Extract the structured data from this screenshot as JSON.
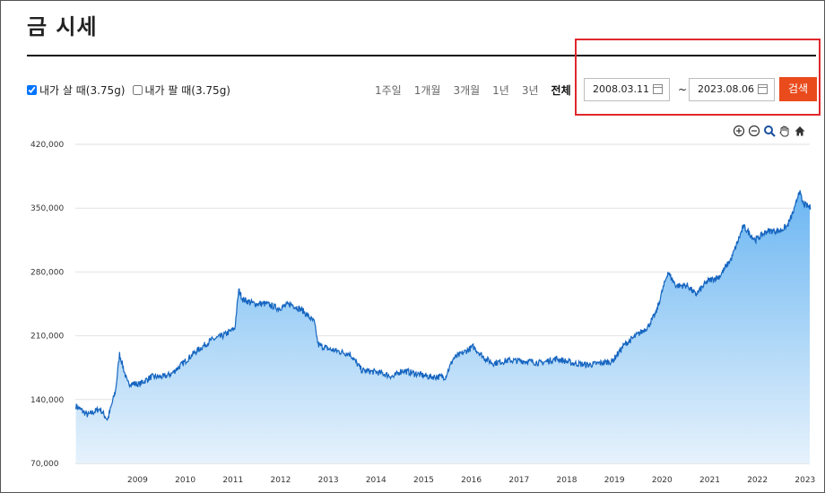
{
  "page": {
    "title": "금 시세"
  },
  "options": [
    {
      "label": "내가 살 때(3.75g)",
      "checked": true
    },
    {
      "label": "내가 팔 때(3.75g)",
      "checked": false
    }
  ],
  "periods": [
    {
      "label": "1주일",
      "active": false
    },
    {
      "label": "1개월",
      "active": false
    },
    {
      "label": "3개월",
      "active": false
    },
    {
      "label": "1년",
      "active": false
    },
    {
      "label": "3년",
      "active": false
    },
    {
      "label": "전체",
      "active": true
    }
  ],
  "date_range": {
    "start": "2008.03.11",
    "separator": "~",
    "end": "2023.08.06"
  },
  "search_button": "검색",
  "toolbar": [
    "zoom-in-icon",
    "zoom-out-icon",
    "magnifier-icon",
    "pan-hand-icon",
    "home-icon"
  ],
  "colors": {
    "accent": "#ea4b1c",
    "highlight": "#e0282e",
    "line": "#1565c0",
    "fill_top": "#6bb6f2",
    "fill_bottom": "#e6f2fc"
  },
  "chart_data": {
    "type": "area",
    "title": "",
    "xlabel": "",
    "ylabel": "",
    "ylim": [
      70000,
      420000
    ],
    "y_ticks": [
      "70,000",
      "140,000",
      "210,000",
      "280,000",
      "350,000",
      "420,000"
    ],
    "y_tick_values": [
      70000,
      140000,
      210000,
      280000,
      350000,
      420000
    ],
    "x_ticks": [
      "2009",
      "2010",
      "2011",
      "2012",
      "2013",
      "2014",
      "2015",
      "2016",
      "2017",
      "2018",
      "2019",
      "2020",
      "2021",
      "2022",
      "2023"
    ],
    "x_range": [
      "2008.03.11",
      "2023.08.06"
    ],
    "grid": true,
    "series": [
      {
        "x": [
          "2008.03",
          "2008.06",
          "2008.09",
          "2008.11",
          "2009.01",
          "2009.02",
          "2009.04",
          "2009.07",
          "2009.10",
          "2010.01",
          "2010.03",
          "2010.06",
          "2010.09",
          "2011.01",
          "2011.04",
          "2011.07",
          "2011.08",
          "2011.09",
          "2011.12",
          "2012.03",
          "2012.06",
          "2012.09",
          "2012.12",
          "2013.03",
          "2013.04",
          "2013.07",
          "2013.12",
          "2014.03",
          "2014.07",
          "2014.11",
          "2015.01",
          "2015.05",
          "2015.08",
          "2015.12",
          "2016.02",
          "2016.07",
          "2016.10",
          "2016.12",
          "2017.04",
          "2017.09",
          "2017.12",
          "2018.04",
          "2018.08",
          "2018.12",
          "2019.03",
          "2019.06",
          "2019.09",
          "2019.12",
          "2020.03",
          "2020.05",
          "2020.08",
          "2020.10",
          "2021.01",
          "2021.03",
          "2021.06",
          "2021.09",
          "2021.12",
          "2022.03",
          "2022.06",
          "2022.09",
          "2022.12",
          "2023.02",
          "2023.04",
          "2023.05",
          "2023.06",
          "2023.08"
        ],
        "y": [
          133000,
          123000,
          130000,
          118000,
          150000,
          190000,
          158000,
          157000,
          165000,
          165000,
          168000,
          180000,
          192000,
          205000,
          210000,
          218000,
          260000,
          250000,
          245000,
          245000,
          240000,
          245000,
          238000,
          225000,
          200000,
          195000,
          190000,
          172000,
          170000,
          165000,
          172000,
          168000,
          165000,
          165000,
          185000,
          198000,
          185000,
          180000,
          183000,
          182000,
          180000,
          185000,
          180000,
          178000,
          180000,
          182000,
          200000,
          210000,
          220000,
          235000,
          280000,
          265000,
          265000,
          255000,
          270000,
          275000,
          295000,
          330000,
          315000,
          325000,
          325000,
          330000,
          350000,
          370000,
          355000,
          350000
        ]
      }
    ]
  }
}
